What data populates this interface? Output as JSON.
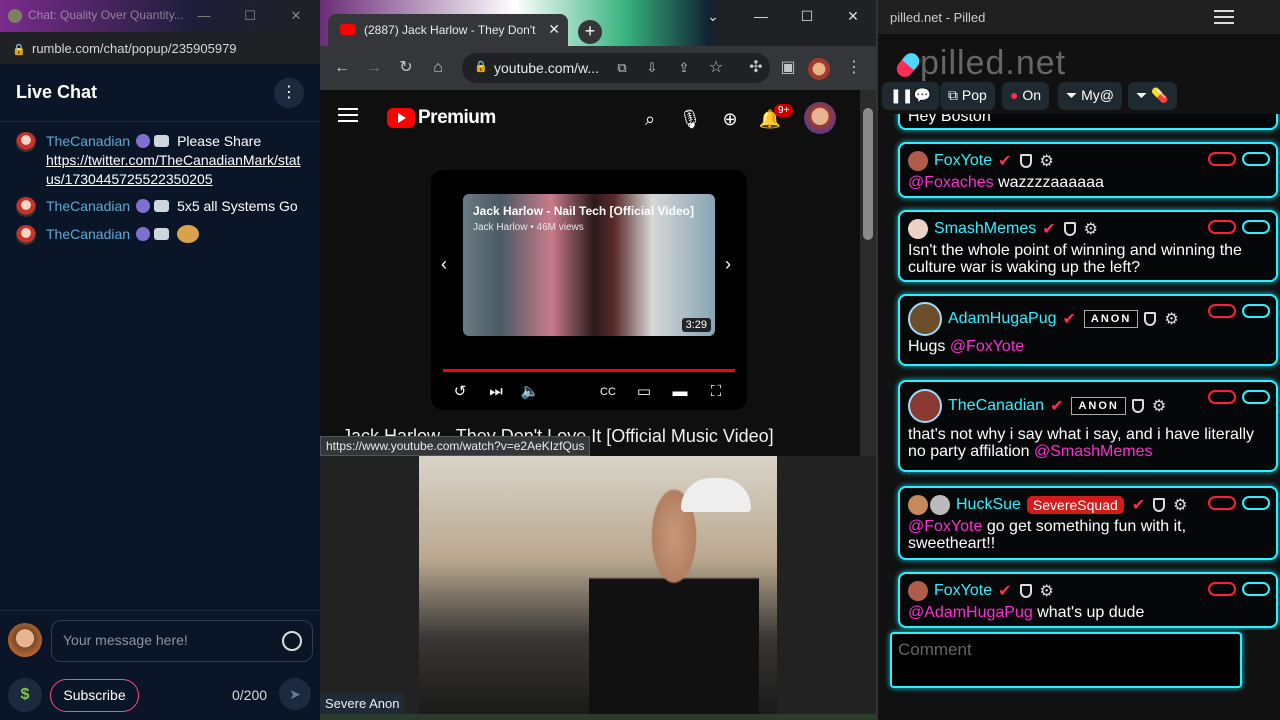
{
  "rumble": {
    "tab_title": "Chat: Quality Over Quantity...",
    "url": "rumble.com/chat/popup/235905979",
    "header_title": "Live Chat",
    "messages": [
      {
        "user": "TheCanadian",
        "text": "Please Share",
        "link": "https://twitter.com/TheCanadianMark/status/1730445725522350205"
      },
      {
        "user": "TheCanadian",
        "text": "5x5 all Systems Go"
      },
      {
        "user": "TheCanadian",
        "text": ""
      }
    ],
    "input_placeholder": "Your message here!",
    "subscribe_label": "Subscribe",
    "char_counter": "0/200",
    "dollar_label": "$"
  },
  "chrome": {
    "tab_title": "(2887) Jack Harlow - They Don't",
    "url": "youtube.com/w...",
    "yt_logo_text": "Premium",
    "notif_count": "9+",
    "mini": {
      "video_title": "Jack Harlow - Nail Tech [Official Video]",
      "video_meta": "Jack Harlow • 46M views",
      "duration": "3:29",
      "progress": 1.0
    },
    "page_title": "Jack Harlow - They Don't Love It [Official Music Video]",
    "status_url": "https://www.youtube.com/watch?v=e2AeKIzfQus"
  },
  "cam": {
    "label": "Severe Anon"
  },
  "pilled": {
    "title": "pilled.net - Pilled",
    "logo": "pilled.net",
    "toolbar": {
      "pop": "Pop",
      "on": "On",
      "my": "My@"
    },
    "partial_message": "Hey Boston",
    "messages": [
      {
        "user": "FoxYote",
        "mention": "@Foxaches",
        "text": "wazzzzaaaaaa"
      },
      {
        "user": "SmashMemes",
        "mention": "",
        "text": "Isn't the whole point of winning and winning the culture war is waking up the left?"
      },
      {
        "user": "AdamHugaPug",
        "badge": "ANON",
        "text_before": "Hugs",
        "mention": "@FoxYote"
      },
      {
        "user": "TheCanadian",
        "badge": "ANON",
        "text_before": "that's not why i say what i say, and i have literally no party affilation",
        "mention": "@SmashMemes"
      },
      {
        "user": "HuckSue",
        "squad": "SevereSquad",
        "mention": "@FoxYote",
        "text": "go get something fun with it, sweetheart!!"
      },
      {
        "user": "FoxYote",
        "mention": "@AdamHugaPug",
        "text": "what's up dude"
      }
    ],
    "comment_placeholder": "Comment"
  },
  "colors": {
    "rumble_bg": "#0a1628",
    "rumble_username": "#5fa8d3",
    "pilled_border": "#2ff0ff",
    "pilled_mention": "#ff2dd2",
    "youtube_red": "#ff0000"
  }
}
